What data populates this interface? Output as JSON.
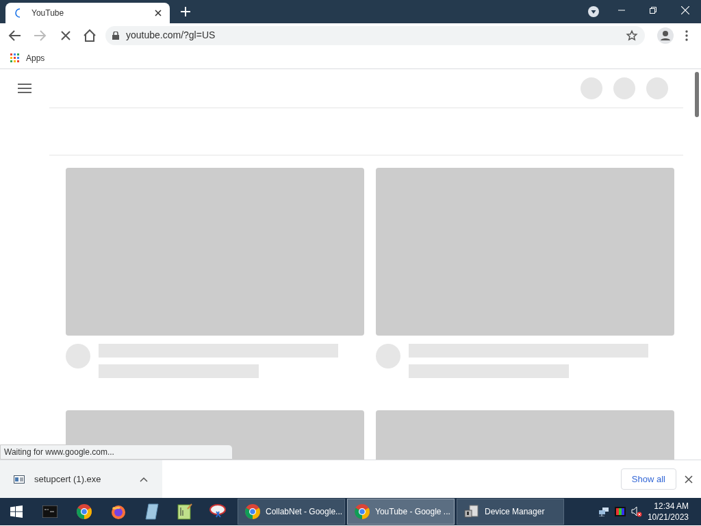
{
  "tabs": [
    {
      "title": "YouTube",
      "selected": true,
      "loading": true
    }
  ],
  "address_bar": {
    "url": "youtube.com/?gl=US"
  },
  "bookmarks": [
    "Apps"
  ],
  "status_bubble": "Waiting for www.google.com...",
  "download_bar": {
    "file": "setupcert (1).exe",
    "show_all": "Show all"
  },
  "taskbar": {
    "windows": [
      {
        "label": "CollabNet - Google...",
        "selected": false,
        "kind": "chrome"
      },
      {
        "label": "YouTube - Google ...",
        "selected": true,
        "kind": "chrome"
      },
      {
        "label": "Device Manager",
        "selected": false,
        "kind": "device"
      }
    ],
    "time": "12:34 AM",
    "date": "10/21/2023"
  }
}
